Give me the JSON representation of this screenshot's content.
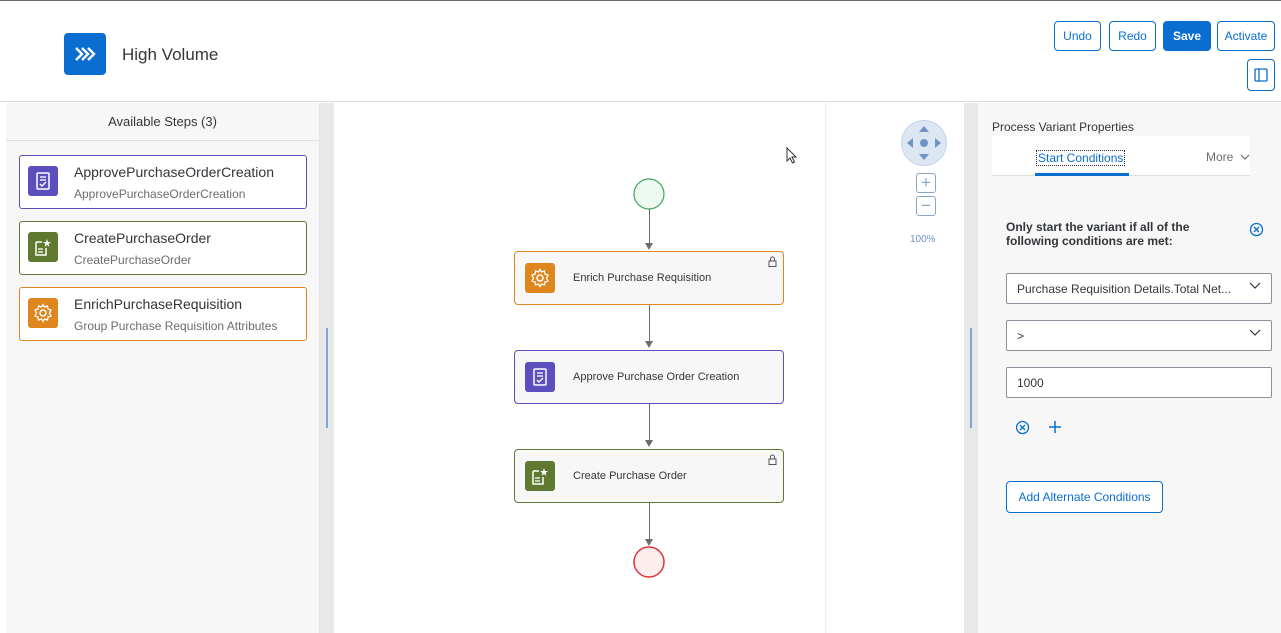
{
  "header": {
    "app_icon": "double-chevron-right-icon",
    "title": "High Volume",
    "buttons": {
      "undo": "Undo",
      "redo": "Redo",
      "save": "Save",
      "activate": "Activate"
    },
    "accent": "#0a6ed1"
  },
  "left_panel": {
    "title": "Available Steps (3)",
    "steps": [
      {
        "title": "ApprovePurchaseOrderCreation",
        "subtitle": "ApprovePurchaseOrderCreation",
        "icon": "approval-document-icon",
        "color": "#5b4fbd"
      },
      {
        "title": "CreatePurchaseOrder",
        "subtitle": "CreatePurchaseOrder",
        "icon": "create-document-icon",
        "color": "#5f7a30"
      },
      {
        "title": "EnrichPurchaseRequisition",
        "subtitle": "Group Purchase Requisition Attributes",
        "icon": "gear-icon",
        "color": "#e0861f"
      }
    ]
  },
  "canvas": {
    "nodes": [
      {
        "label": "Enrich Purchase Requisition",
        "icon": "gear-icon",
        "locked": true
      },
      {
        "label": "Approve Purchase Order Creation",
        "icon": "approval-document-icon",
        "locked": false
      },
      {
        "label": "Create Purchase Order",
        "icon": "create-document-icon",
        "locked": true
      }
    ],
    "zoom_label": "100%"
  },
  "right_panel": {
    "title": "Process Variant Properties",
    "tabs": {
      "active": "Start Conditions",
      "more": "More"
    },
    "condition_text": "Only start the variant if all of the following conditions are met:",
    "field_attribute": "Purchase Requisition Details.Total Net...",
    "field_operator": ">",
    "field_value": "1000",
    "add_alternate": "Add Alternate Conditions"
  }
}
